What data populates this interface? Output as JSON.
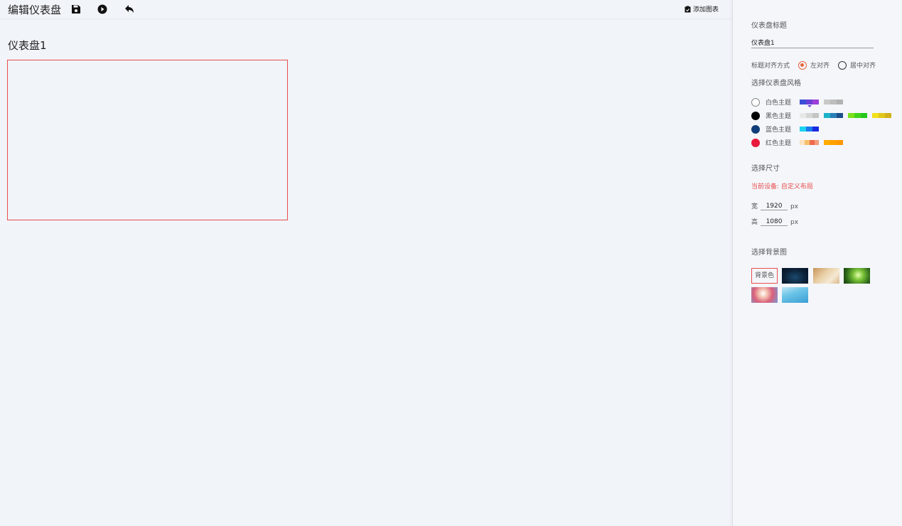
{
  "toolbar": {
    "title": "编辑仪表盘",
    "icons": [
      "save-icon",
      "play-icon",
      "undo-icon"
    ],
    "add_chart_label": "添加图表"
  },
  "dashboard": {
    "title": "仪表盘1",
    "border_color": "#e84e4e"
  },
  "panel": {
    "title_label": "仪表盘标题",
    "title_value": "仪表盘1",
    "align_label": "标题对齐方式",
    "align_options": [
      {
        "label": "左对齐",
        "selected": true
      },
      {
        "label": "居中对齐",
        "selected": false
      }
    ],
    "theme_label": "选择仪表盘风格",
    "themes": [
      {
        "name": "白色主题",
        "dot": "#ffffff",
        "swatches": [
          [
            "#3a4fd6",
            "#6a3fd8",
            "#9b3fd8"
          ],
          [
            "#c8c8c8",
            "#bdbdbd",
            "#b2b2b2"
          ]
        ]
      },
      {
        "name": "黑色主题",
        "dot": "#000000",
        "swatches": [
          [
            "#e8e8e8",
            "#d6d6d6",
            "#c4c4c4"
          ],
          [
            "#1bb3c8",
            "#2a7fb8",
            "#1d4f8a"
          ],
          [
            "#7ae01a",
            "#3fd21a",
            "#22c71a"
          ],
          [
            "#f0e01a",
            "#e0c81a",
            "#d2b01a"
          ]
        ]
      },
      {
        "name": "蓝色主题",
        "dot": "#0f3e7a",
        "swatches": [
          [
            "#1ad4f0",
            "#1a7af0",
            "#1a2ae0"
          ]
        ]
      },
      {
        "name": "红色主题",
        "dot": "#e8193c",
        "swatches": [
          [
            "#fce3c4",
            "#f6c06a",
            "#ef6a4e",
            "#f49a7a"
          ],
          [
            "#ffab00",
            "#ffa000",
            "#ff9800"
          ]
        ]
      }
    ],
    "size_label": "选择尺寸",
    "device_text": "当前设备: 自定义布局",
    "width_label": "宽",
    "width_value": "1920",
    "height_label": "高",
    "height_value": "1080",
    "unit": "px",
    "bg_label": "选择背景图",
    "bg_color_label": "背景色"
  }
}
